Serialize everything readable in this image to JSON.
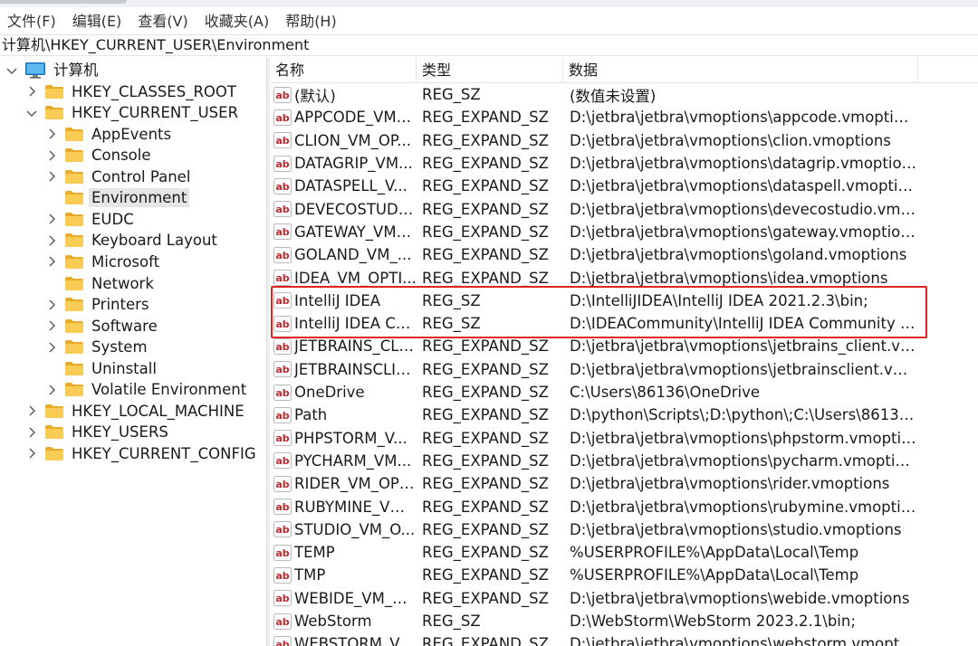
{
  "menu": [
    "文件(F)",
    "编辑(E)",
    "查看(V)",
    "收藏夹(A)",
    "帮助(H)"
  ],
  "address": "计算机\\HKEY_CURRENT_USER\\Environment",
  "tree": [
    {
      "label": "计算机",
      "level": 0,
      "expanded": true,
      "type": "computer"
    },
    {
      "label": "HKEY_CLASSES_ROOT",
      "level": 1,
      "expanded": false
    },
    {
      "label": "HKEY_CURRENT_USER",
      "level": 1,
      "expanded": true
    },
    {
      "label": "AppEvents",
      "level": 2,
      "expanded": false
    },
    {
      "label": "Console",
      "level": 2,
      "expanded": false
    },
    {
      "label": "Control Panel",
      "level": 2,
      "expanded": false
    },
    {
      "label": "Environment",
      "level": 2,
      "expanded": null,
      "selected": true
    },
    {
      "label": "EUDC",
      "level": 2,
      "expanded": false
    },
    {
      "label": "Keyboard Layout",
      "level": 2,
      "expanded": false
    },
    {
      "label": "Microsoft",
      "level": 2,
      "expanded": false
    },
    {
      "label": "Network",
      "level": 2,
      "expanded": null
    },
    {
      "label": "Printers",
      "level": 2,
      "expanded": false
    },
    {
      "label": "Software",
      "level": 2,
      "expanded": false
    },
    {
      "label": "System",
      "level": 2,
      "expanded": false
    },
    {
      "label": "Uninstall",
      "level": 2,
      "expanded": null
    },
    {
      "label": "Volatile Environment",
      "level": 2,
      "expanded": false
    },
    {
      "label": "HKEY_LOCAL_MACHINE",
      "level": 1,
      "expanded": false
    },
    {
      "label": "HKEY_USERS",
      "level": 1,
      "expanded": false
    },
    {
      "label": "HKEY_CURRENT_CONFIG",
      "level": 1,
      "expanded": false
    }
  ],
  "columns": {
    "name": "名称",
    "type": "类型",
    "data": "数据"
  },
  "values": [
    {
      "name": "(默认)",
      "type": "REG_SZ",
      "data": "(数值未设置)"
    },
    {
      "name": "APPCODE_VM_...",
      "type": "REG_EXPAND_SZ",
      "data": "D:\\jetbra\\jetbra\\vmoptions\\appcode.vmoptions"
    },
    {
      "name": "CLION_VM_OP...",
      "type": "REG_EXPAND_SZ",
      "data": "D:\\jetbra\\jetbra\\vmoptions\\clion.vmoptions"
    },
    {
      "name": "DATAGRIP_VM...",
      "type": "REG_EXPAND_SZ",
      "data": "D:\\jetbra\\jetbra\\vmoptions\\datagrip.vmoptions"
    },
    {
      "name": "DATASPELL_V...",
      "type": "REG_EXPAND_SZ",
      "data": "D:\\jetbra\\jetbra\\vmoptions\\dataspell.vmoptions"
    },
    {
      "name": "DEVECOSTUDI...",
      "type": "REG_EXPAND_SZ",
      "data": "D:\\jetbra\\jetbra\\vmoptions\\devecostudio.vmop..."
    },
    {
      "name": "GATEWAY_VM_...",
      "type": "REG_EXPAND_SZ",
      "data": "D:\\jetbra\\jetbra\\vmoptions\\gateway.vmoptions"
    },
    {
      "name": "GOLAND_VM_...",
      "type": "REG_EXPAND_SZ",
      "data": "D:\\jetbra\\jetbra\\vmoptions\\goland.vmoptions"
    },
    {
      "name": "IDEA_VM_OPTI...",
      "type": "REG_EXPAND_SZ",
      "data": "D:\\jetbra\\jetbra\\vmoptions\\idea.vmoptions"
    },
    {
      "name": "IntelliJ IDEA",
      "type": "REG_SZ",
      "data": "D:\\IntelliJIDEA\\IntelliJ IDEA 2021.2.3\\bin;"
    },
    {
      "name": "IntelliJ IDEA Co...",
      "type": "REG_SZ",
      "data": "D:\\IDEACommunity\\IntelliJ IDEA Community E..."
    },
    {
      "name": "JETBRAINS_CLI...",
      "type": "REG_EXPAND_SZ",
      "data": "D:\\jetbra\\jetbra\\vmoptions\\jetbrains_client.vm..."
    },
    {
      "name": "JETBRAINSCLIE...",
      "type": "REG_EXPAND_SZ",
      "data": "D:\\jetbra\\jetbra\\vmoptions\\jetbrainsclient.vmo..."
    },
    {
      "name": "OneDrive",
      "type": "REG_EXPAND_SZ",
      "data": "C:\\Users\\86136\\OneDrive"
    },
    {
      "name": "Path",
      "type": "REG_EXPAND_SZ",
      "data": "D:\\python\\Scripts\\;D:\\python\\;C:\\Users\\86136\\..."
    },
    {
      "name": "PHPSTORM_V...",
      "type": "REG_EXPAND_SZ",
      "data": "D:\\jetbra\\jetbra\\vmoptions\\phpstorm.vmoptions"
    },
    {
      "name": "PYCHARM_VM...",
      "type": "REG_EXPAND_SZ",
      "data": "D:\\jetbra\\jetbra\\vmoptions\\pycharm.vmoptions"
    },
    {
      "name": "RIDER_VM_OPT...",
      "type": "REG_EXPAND_SZ",
      "data": "D:\\jetbra\\jetbra\\vmoptions\\rider.vmoptions"
    },
    {
      "name": "RUBYMINE_VM...",
      "type": "REG_EXPAND_SZ",
      "data": "D:\\jetbra\\jetbra\\vmoptions\\rubymine.vmoptions"
    },
    {
      "name": "STUDIO_VM_O...",
      "type": "REG_EXPAND_SZ",
      "data": "D:\\jetbra\\jetbra\\vmoptions\\studio.vmoptions"
    },
    {
      "name": "TEMP",
      "type": "REG_EXPAND_SZ",
      "data": "%USERPROFILE%\\AppData\\Local\\Temp"
    },
    {
      "name": "TMP",
      "type": "REG_EXPAND_SZ",
      "data": "%USERPROFILE%\\AppData\\Local\\Temp"
    },
    {
      "name": "WEBIDE_VM_O...",
      "type": "REG_EXPAND_SZ",
      "data": "D:\\jetbra\\jetbra\\vmoptions\\webide.vmoptions"
    },
    {
      "name": "WebStorm",
      "type": "REG_SZ",
      "data": "D:\\WebStorm\\WebStorm 2023.2.1\\bin;"
    },
    {
      "name": "WEBSTORM_V...",
      "type": "REG_EXPAND_SZ",
      "data": "D:\\jetbra\\jetbra\\vmoptions\\webstorm.vmoptions"
    }
  ],
  "colors": {
    "highlight": "#e02424",
    "folder": "#f5c342",
    "selected_bg": "#e5e5e5"
  }
}
